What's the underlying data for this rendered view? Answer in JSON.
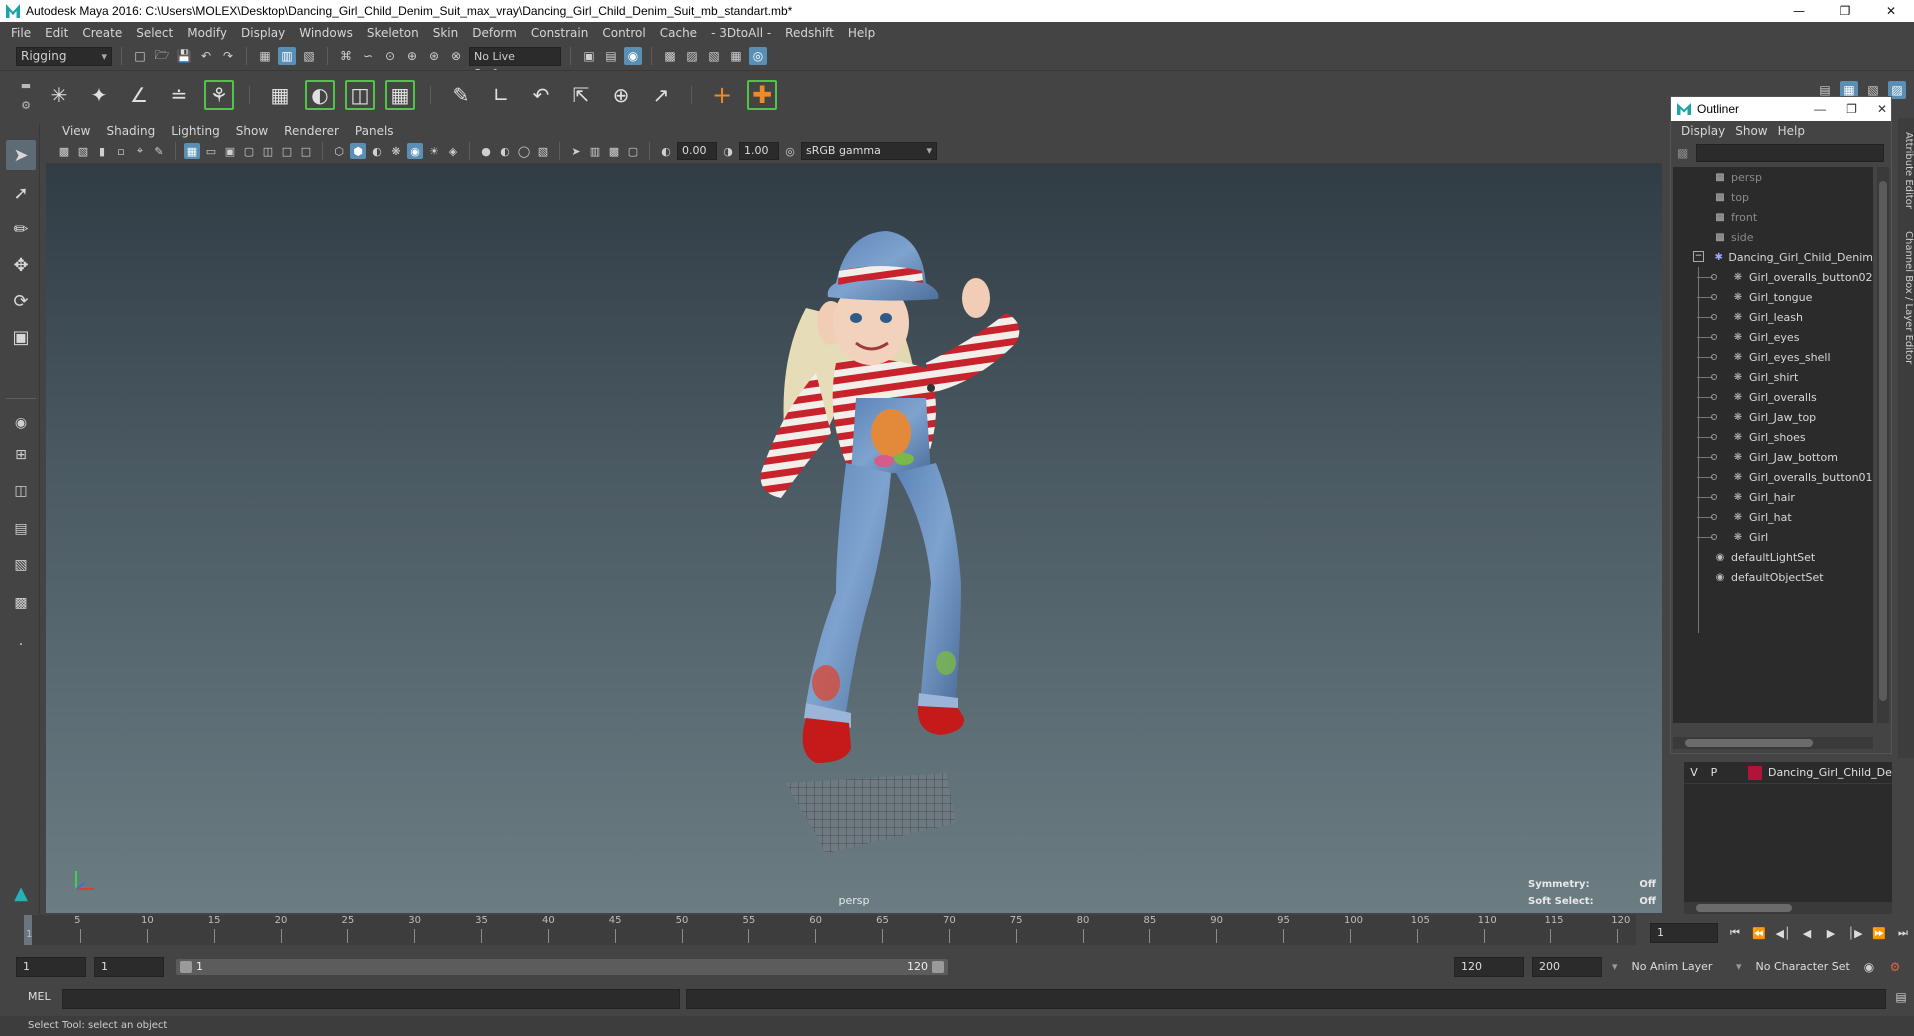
{
  "window": {
    "title": "Autodesk Maya 2016: C:\\Users\\MOLEX\\Desktop\\Dancing_Girl_Child_Denim_Suit_max_vray\\Dancing_Girl_Child_Denim_Suit_mb_standart.mb*",
    "minimize": "—",
    "restore": "❐",
    "close": "✕"
  },
  "menubar": {
    "items": [
      "File",
      "Edit",
      "Create",
      "Select",
      "Modify",
      "Display",
      "Windows",
      "Skeleton",
      "Skin",
      "Deform",
      "Constrain",
      "Control",
      "Cache",
      "- 3DtoAll -",
      "Redshift",
      "Help"
    ]
  },
  "statusline": {
    "menuset": "Rigging",
    "live_surface": "No Live Surface"
  },
  "panel": {
    "menus": [
      "View",
      "Shading",
      "Lighting",
      "Show",
      "Renderer",
      "Panels"
    ],
    "exposure": "0.00",
    "gamma_value": "1.00",
    "color_space": "sRGB gamma",
    "camera": "persp",
    "hud": {
      "symmetry_label": "Symmetry:",
      "symmetry_value": "Off",
      "soft_select_label": "Soft Select:",
      "soft_select_value": "Off"
    }
  },
  "outliner": {
    "title": "Outliner",
    "menus": [
      "Display",
      "Show",
      "Help"
    ],
    "cameras": [
      "persp",
      "top",
      "front",
      "side"
    ],
    "group": "Dancing_Girl_Child_Denim",
    "children": [
      "Girl_overalls_button02",
      "Girl_tongue",
      "Girl_leash",
      "Girl_eyes",
      "Girl_eyes_shell",
      "Girl_shirt",
      "Girl_overalls",
      "Girl_Jaw_top",
      "Girl_shoes",
      "Girl_Jaw_bottom",
      "Girl_overalls_button01",
      "Girl_hair",
      "Girl_hat",
      "Girl"
    ],
    "sets": [
      "defaultLightSet",
      "defaultObjectSet"
    ]
  },
  "side_tabs": [
    "Attribute Editor",
    "Channel Box / Layer Editor"
  ],
  "layer_editor": {
    "visible": "V",
    "playback": "P",
    "layer_name": "Dancing_Girl_Child_De",
    "layer_color": "#b3133a"
  },
  "timeline": {
    "ticks": [
      "5",
      "10",
      "15",
      "20",
      "25",
      "30",
      "35",
      "40",
      "45",
      "50",
      "55",
      "60",
      "65",
      "70",
      "75",
      "80",
      "85",
      "90",
      "95",
      "100",
      "105",
      "110",
      "115",
      "120"
    ],
    "first_frame_label": "1",
    "current_frame": "1"
  },
  "range": {
    "start": "1",
    "playback_start": "1",
    "slider_start": "1",
    "slider_end": "120",
    "playback_end": "120",
    "end": "200",
    "anim_layer": "No Anim Layer",
    "character_set": "No Character Set"
  },
  "commandline": {
    "language": "MEL"
  },
  "helpline": {
    "text": "Select Tool: select an object"
  }
}
